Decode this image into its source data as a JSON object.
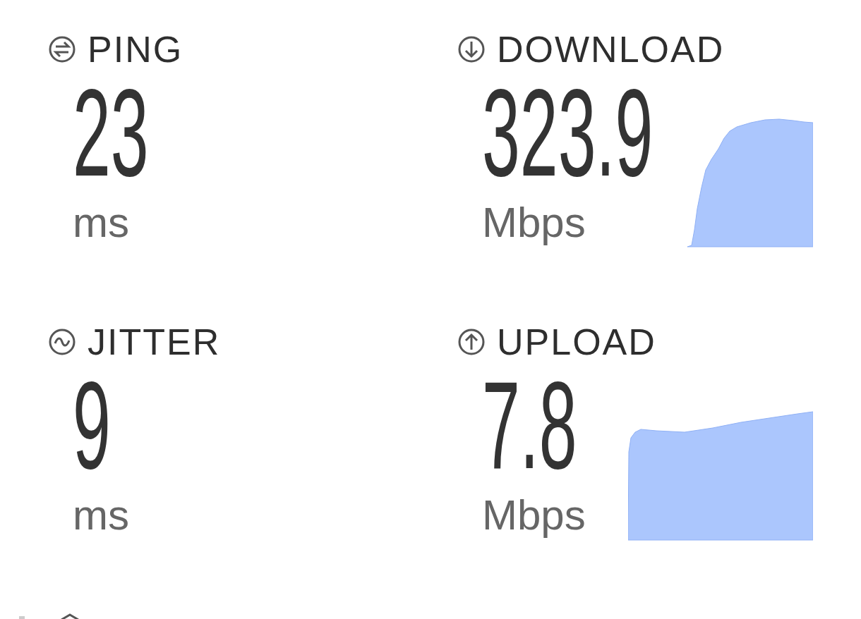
{
  "metrics": [
    {
      "kind": "ping",
      "label": "PING",
      "value": "23",
      "unit": "ms"
    },
    {
      "kind": "download",
      "label": "DOWNLOAD",
      "value": "323.9",
      "unit": "Mbps"
    },
    {
      "kind": "jitter",
      "label": "JITTER",
      "value": "9",
      "unit": "ms"
    },
    {
      "kind": "upload",
      "label": "UPLOAD",
      "value": "7.8",
      "unit": "Mbps"
    }
  ]
}
